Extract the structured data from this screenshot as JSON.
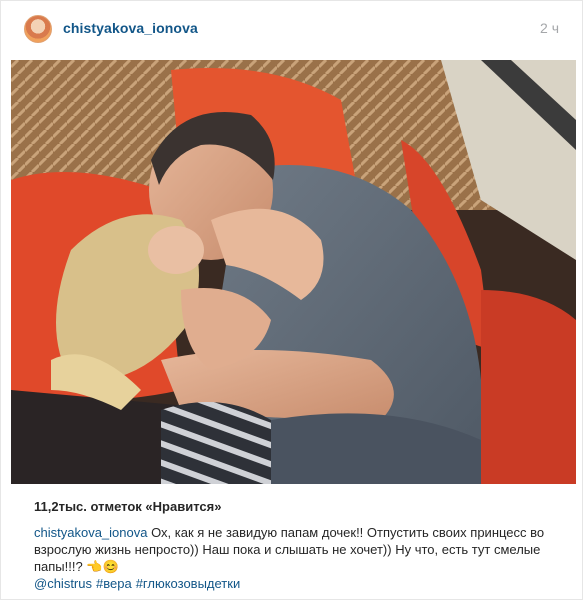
{
  "post": {
    "username": "chistyakova_ionova",
    "time_ago": "2 ч"
  },
  "likes": {
    "text": "11,2тыс. отметок «Нравится»"
  },
  "caption": {
    "username": "chistyakova_ionova",
    "text": "Ох, как я не завидую папам дочек!! Отпустить своих принцесс во взрослую жизнь непросто)) Наш пока и слышать не хочет)) Ну что, есть тут смелые папы!!!? 👈😊"
  },
  "tags": [
    "@chistrus",
    "#вера",
    "#глюкозовыдетки"
  ],
  "colors": {
    "link": "#125688",
    "muted": "#a5a7aa",
    "text": "#262626"
  }
}
